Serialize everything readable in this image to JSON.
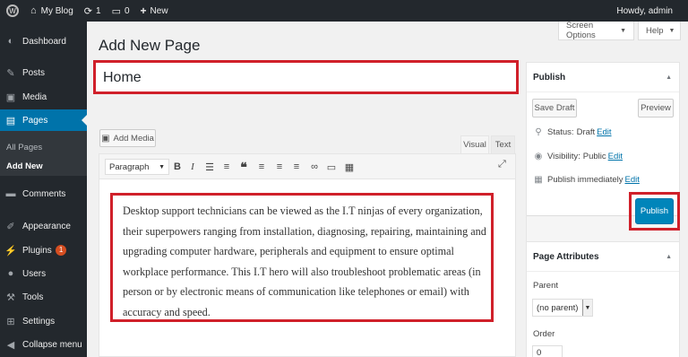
{
  "adminbar": {
    "site_name": "My Blog",
    "updates_count": "1",
    "comments_count": "0",
    "new_label": "New",
    "greeting": "Howdy, admin"
  },
  "sidebar": {
    "items": [
      {
        "label": "Dashboard",
        "icon": "dashboard-icon"
      },
      {
        "label": "Posts",
        "icon": "pin-icon"
      },
      {
        "label": "Media",
        "icon": "media-icon"
      },
      {
        "label": "Pages",
        "icon": "pages-icon"
      },
      {
        "label": "Comments",
        "icon": "comments-icon"
      },
      {
        "label": "Appearance",
        "icon": "paintbrush-icon"
      },
      {
        "label": "Plugins",
        "icon": "plugin-icon",
        "badge": "1"
      },
      {
        "label": "Users",
        "icon": "users-icon"
      },
      {
        "label": "Tools",
        "icon": "wrench-icon"
      },
      {
        "label": "Settings",
        "icon": "settings-icon"
      },
      {
        "label": "Collapse menu",
        "icon": "collapse-icon"
      }
    ],
    "submenu": [
      "All Pages",
      "Add New"
    ]
  },
  "header": {
    "title": "Add New Page",
    "screen_options": "Screen Options",
    "help": "Help"
  },
  "editor": {
    "title_value": "Home",
    "add_media": "Add Media",
    "tab_visual": "Visual",
    "tab_text": "Text",
    "format_select": "Paragraph",
    "content": "Desktop support technicians can be viewed as the I.T ninjas of every organization, their superpowers ranging from installation, diagnosing, repairing, maintaining and upgrading computer hardware, peripherals and equipment to ensure optimal workplace performance. This I.T hero will also troubleshoot problematic areas (in person or by electronic means of communication like telephones or email) with accuracy and speed."
  },
  "publish": {
    "title": "Publish",
    "save_draft": "Save Draft",
    "preview": "Preview",
    "status_label": "Status:",
    "status_value": "Draft",
    "visibility_label": "Visibility:",
    "visibility_value": "Public",
    "schedule_label": "Publish immediately",
    "edit_link": "Edit",
    "publish_button": "Publish"
  },
  "page_attributes": {
    "title": "Page Attributes",
    "parent_label": "Parent",
    "parent_value": "(no parent)",
    "order_label": "Order",
    "order_value": "0"
  },
  "colors": {
    "adminbar_bg": "#23282d",
    "accent": "#0073aa",
    "highlight": "#d0202a",
    "publish_button": "#0085ba"
  }
}
